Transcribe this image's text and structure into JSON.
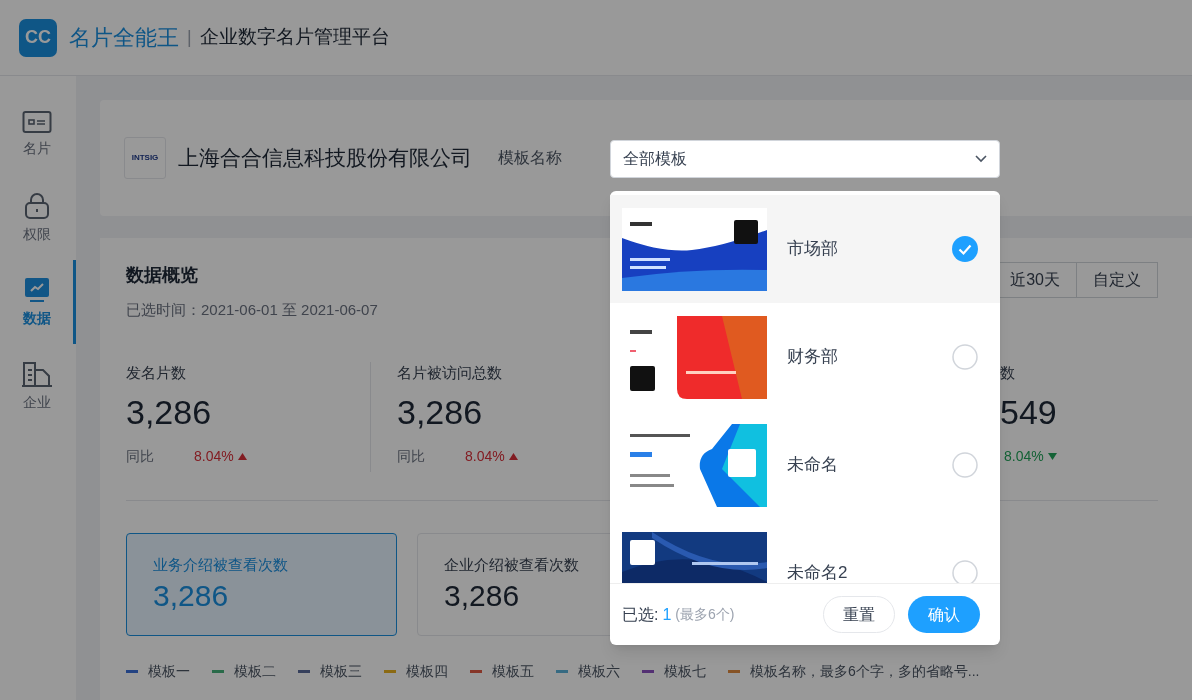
{
  "header": {
    "logo": "CC",
    "app_name": "名片全能王",
    "divider": "|",
    "platform": "企业数字名片管理平台"
  },
  "sidebar": {
    "items": [
      {
        "kind": "card",
        "label": "名片",
        "selected": false
      },
      {
        "kind": "lock",
        "label": "权限",
        "selected": false
      },
      {
        "kind": "chart",
        "label": "数据",
        "selected": true
      },
      {
        "kind": "building",
        "label": "企业",
        "selected": false
      }
    ]
  },
  "company": {
    "logo": "INTSIG",
    "name": "上海合合信息科技股份有限公司",
    "template_label": "模板名称",
    "template_select": {
      "value": "全部模板"
    }
  },
  "overview": {
    "title": "数据概览",
    "range": "已选时间：2021-06-01 至 2021-06-07",
    "ranges": [
      "近30天",
      "自定义"
    ],
    "stats": [
      {
        "label": "发名片数",
        "value": "3,286",
        "compare": "同比",
        "change": "8.04%",
        "rising": true
      },
      {
        "label": "名片被访问总数",
        "value": "3,286",
        "compare": "同比",
        "change": "8.04%",
        "rising": true
      },
      {
        "label": "数",
        "value": "549",
        "change": "8.04%",
        "rising": false
      }
    ],
    "metric_cards": [
      {
        "label": "业务介绍被查看次数",
        "value": "3,286",
        "selected": true
      },
      {
        "label": "企业介绍被查看次数",
        "value": "3,286",
        "selected": false
      }
    ],
    "legend": [
      {
        "label": "模板一",
        "color": "#234382"
      },
      {
        "label": "模板二",
        "color": "#296a49"
      },
      {
        "label": "模板三",
        "color": "#36405c"
      },
      {
        "label": "模板四",
        "color": "#8b6a13"
      },
      {
        "label": "模板五",
        "color": "#863629"
      },
      {
        "label": "模板六",
        "color": "#366a82"
      },
      {
        "label": "模板七",
        "color": "#533073"
      },
      {
        "label": "模板名称，最多6个字，多的省略号...",
        "color": "#865326"
      }
    ]
  },
  "template_dropdown": {
    "options": [
      {
        "name": "市场部",
        "selected": true
      },
      {
        "name": "财务部",
        "selected": false
      },
      {
        "name": "未命名",
        "selected": false
      },
      {
        "name": "未命名2",
        "selected": false
      }
    ],
    "footer": {
      "selected_label": "已选:",
      "selected_count": "1",
      "limit_note": "(最多6个)",
      "reset": "重置",
      "confirm": "确认"
    }
  }
}
